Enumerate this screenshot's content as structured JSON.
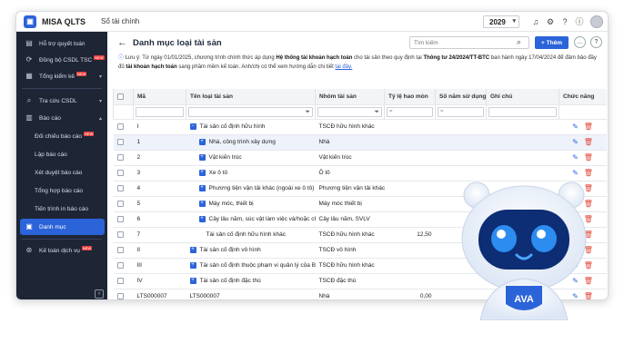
{
  "app": {
    "name": "MISA QLTS",
    "module": "Sổ tài chính",
    "year": "2029"
  },
  "sidebar": {
    "items": [
      {
        "label": "Hỗ trợ quyết toán",
        "icon": "doc-icon",
        "new": false
      },
      {
        "label": "Đồng bộ CSDL TSC",
        "icon": "sync-icon",
        "new": true
      },
      {
        "label": "Tổng kiểm kê",
        "icon": "inventory-icon",
        "new": true
      },
      {
        "label": "Tra cứu CSDL",
        "icon": "search-icon",
        "new": false
      },
      {
        "label": "Báo cáo",
        "icon": "report-icon",
        "new": false
      },
      {
        "label": "Đối chiếu báo cáo",
        "new": true
      },
      {
        "label": "Lập báo cáo",
        "new": false
      },
      {
        "label": "Xét duyệt báo cáo",
        "new": false
      },
      {
        "label": "Tổng hợp báo cáo",
        "new": false
      },
      {
        "label": "Tiến trình in báo cáo",
        "new": false
      },
      {
        "label": "Danh mục",
        "icon": "list-icon",
        "new": false
      },
      {
        "label": "Kế toán dịch vụ",
        "icon": "service-icon",
        "new": true
      }
    ],
    "new_label": "NEW"
  },
  "page": {
    "title": "Danh mục loại tài sản",
    "search_placeholder": "Tìm kiếm",
    "add_label": "+ Thêm"
  },
  "notice": {
    "prefix": "Lưu ý: Từ ngày 01/01/2025, chương trình chính thức áp dụng ",
    "b1": "Hệ thống tài khoản hạch toán",
    "mid1": " cho tài sản theo quy định tại ",
    "b2": "Thông tư 24/2024/TT-BTC",
    "mid2": " ban hành ngày 17/04/2024 để đảm bảo đầy đủ ",
    "b3": "tài khoản hạch toán",
    "mid3": " sang phầm mềm kế toán. Anh/chị có thể xem hướng dẫn chi tiết ",
    "link": "tại đây."
  },
  "table": {
    "headers": [
      "Mã",
      "Tên loại tài sản",
      "Nhóm tài sản",
      "Tỷ lệ hao mòn",
      "Số năm sử dụng",
      "Ghi chú",
      "Chức năng"
    ],
    "rows": [
      {
        "code": "I",
        "name": "Tài sản cố định hữu hình",
        "group": "TSCĐ hữu hình khác",
        "rate": "",
        "years": "",
        "note": "",
        "indent": 0,
        "exp": "minus"
      },
      {
        "code": "1",
        "name": "Nhà, công trình xây dựng",
        "group": "Nhà",
        "rate": "",
        "years": "",
        "note": "",
        "indent": 1,
        "exp": "plus"
      },
      {
        "code": "2",
        "name": "Vật kiến trúc",
        "group": "Vật kiến trúc",
        "rate": "",
        "years": "",
        "note": "",
        "indent": 1,
        "exp": "plus"
      },
      {
        "code": "3",
        "name": "Xe ô tô",
        "group": "Ô tô",
        "rate": "",
        "years": "",
        "note": "",
        "indent": 1,
        "exp": "plus"
      },
      {
        "code": "4",
        "name": "Phương tiện vận tải khác (ngoài xe ô tô)",
        "group": "Phương tiện vận tải khác",
        "rate": "",
        "years": "",
        "note": "",
        "indent": 1,
        "exp": "plus"
      },
      {
        "code": "5",
        "name": "Máy móc, thiết bị",
        "group": "Máy móc thiết bị",
        "rate": "",
        "years": "",
        "note": "",
        "indent": 1,
        "exp": "plus"
      },
      {
        "code": "6",
        "name": "Cây lâu năm, súc vật làm việc và/hoặc ch...",
        "group": "Cây lâu năm, SVLV",
        "rate": "",
        "years": "",
        "note": "",
        "indent": 1,
        "exp": "plus"
      },
      {
        "code": "7",
        "name": "Tài sản cố định hữu hình khác",
        "group": "TSCĐ hữu hình khác",
        "rate": "12,50",
        "years": "",
        "note": "",
        "indent": 2,
        "exp": ""
      },
      {
        "code": "II",
        "name": "Tài sản cố định vô hình",
        "group": "TSCĐ vô hình",
        "rate": "",
        "years": "",
        "note": "",
        "indent": 0,
        "exp": "plus"
      },
      {
        "code": "III",
        "name": "Tài sản cố định thuộc phạm vi quản lý của Bộ...",
        "group": "TSCĐ hữu hình khác",
        "rate": "",
        "years": "",
        "note": "",
        "indent": 0,
        "exp": "plus"
      },
      {
        "code": "IV",
        "name": "Tài sản cố định đặc thù",
        "group": "TSCĐ đặc thù",
        "rate": "",
        "years": "",
        "note": "",
        "indent": 0,
        "exp": "plus"
      },
      {
        "code": "LTS000007",
        "name": "LTS000007",
        "group": "Nhà",
        "rate": "0,00",
        "years": "",
        "note": "",
        "indent": 0,
        "exp": ""
      }
    ]
  },
  "colors": {
    "accent": "#2b63d9",
    "sidebar": "#1e2535",
    "delete": "#e24a3b"
  }
}
